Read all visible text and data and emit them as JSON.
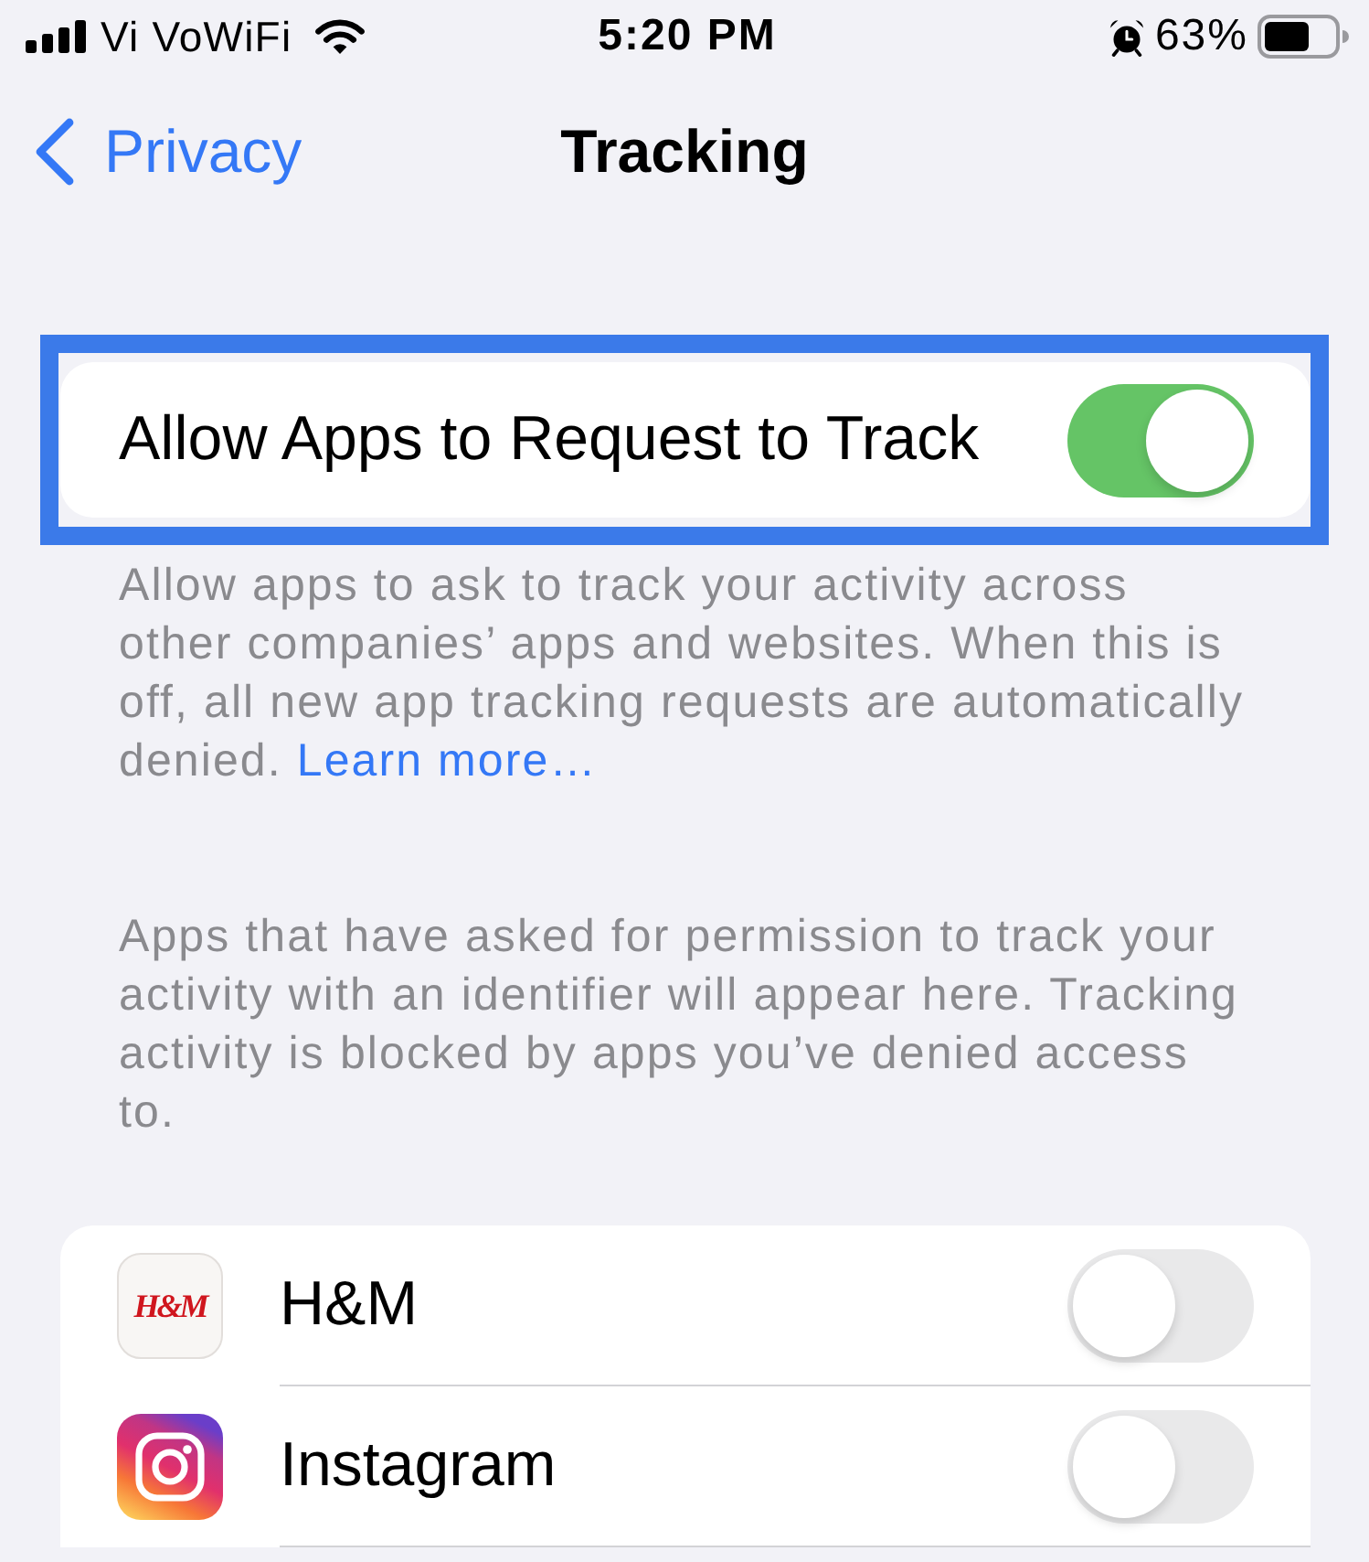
{
  "status_bar": {
    "carrier": "Vi VoWiFi",
    "time": "5:20 PM",
    "battery_percent": "63%"
  },
  "nav": {
    "back_label": "Privacy",
    "title": "Tracking"
  },
  "main_setting": {
    "label": "Allow Apps to Request to Track",
    "on": true,
    "highlighted": true
  },
  "main_footer": {
    "lines": [
      "Allow apps to ask to track your activity across",
      "other companies’ apps and websites. When this is",
      "off, all new app tracking requests are automatically",
      "denied."
    ],
    "link": "Learn more…"
  },
  "apps_description": {
    "lines": [
      "Apps that have asked for permission to track your",
      "activity with an identifier will appear here. Tracking",
      "activity is blocked by apps you’ve denied access",
      "to."
    ]
  },
  "apps": [
    {
      "name": "H&M",
      "kind": "text-logo",
      "logo_text": "H&M",
      "on": false
    },
    {
      "name": "Instagram",
      "kind": "camera-glyph",
      "on": false
    }
  ]
}
